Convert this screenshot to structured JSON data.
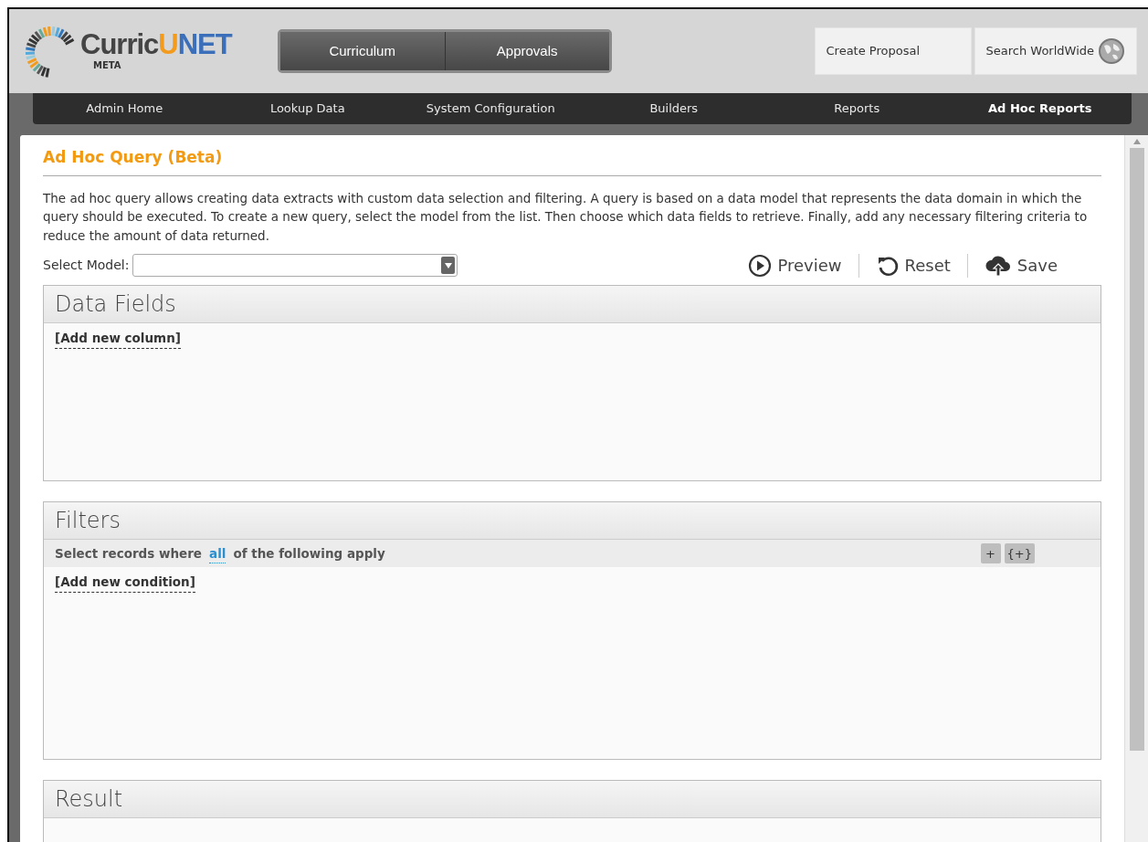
{
  "header": {
    "logo_parts": [
      {
        "text": "Curric",
        "kind": "base"
      },
      {
        "text": "U",
        "kind": "accent"
      },
      {
        "text": "NET",
        "kind": "brand"
      }
    ],
    "logo_sub": "META",
    "main_tabs": [
      "Curriculum",
      "Approvals"
    ],
    "actions": [
      {
        "label": "Create Proposal",
        "kind": "plain"
      },
      {
        "label": "Search WorldWide",
        "kind": "globe"
      }
    ]
  },
  "nav": [
    {
      "label": "Admin Home",
      "selected": false
    },
    {
      "label": "Lookup Data",
      "selected": false
    },
    {
      "label": "System Configuration",
      "selected": false
    },
    {
      "label": "Builders",
      "selected": false
    },
    {
      "label": "Reports",
      "selected": false
    },
    {
      "label": "Ad Hoc Reports",
      "selected": true
    }
  ],
  "page": {
    "title": "Ad Hoc Query (Beta)",
    "description": "The ad hoc query allows creating data extracts with custom data selection and filtering. A query is based on a data model that represents the data domain in which the query should be executed. To create a new query, select the model from the list. Then choose which data fields to retrieve. Finally, add any necessary filtering criteria to reduce the amount of data returned.",
    "select_label": "Select Model:",
    "toolbar": [
      {
        "label": "Preview",
        "kind": "play"
      },
      {
        "label": "Reset",
        "kind": "reset"
      },
      {
        "label": "Save",
        "kind": "cloud"
      }
    ]
  },
  "data_fields": {
    "title": "Data Fields",
    "add_link": "[Add new column]"
  },
  "filters": {
    "title": "Filters",
    "rule_before": "Select records where",
    "rule_link": "all",
    "rule_after": "of the following apply",
    "buttons": [
      "+",
      "{+}"
    ],
    "add_link": "[Add new condition]"
  },
  "result": {
    "title": "Result"
  }
}
